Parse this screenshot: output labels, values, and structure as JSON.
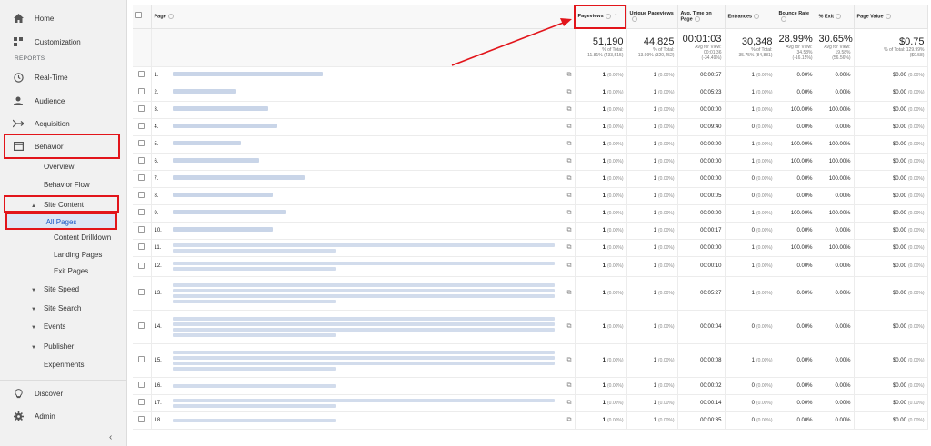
{
  "nav": {
    "home": "Home",
    "customization": "Customization",
    "reports": "REPORTS",
    "realtime": "Real-Time",
    "audience": "Audience",
    "acquisition": "Acquisition",
    "behavior": "Behavior",
    "overview": "Overview",
    "behavior_flow": "Behavior Flow",
    "site_content": "Site Content",
    "all_pages": "All Pages",
    "content_drilldown": "Content Drilldown",
    "landing_pages": "Landing Pages",
    "exit_pages": "Exit Pages",
    "site_speed": "Site Speed",
    "site_search": "Site Search",
    "events": "Events",
    "publisher": "Publisher",
    "experiments": "Experiments",
    "discover": "Discover",
    "admin": "Admin",
    "collapse": "‹"
  },
  "columns": {
    "page": "Page",
    "pageviews": "Pageviews",
    "unique": "Unique Pageviews",
    "avg_time": "Avg. Time on Page",
    "entrances": "Entrances",
    "bounce": "Bounce Rate",
    "exit": "% Exit",
    "value": "Page Value"
  },
  "totals": {
    "pageviews": "51,190",
    "pageviews_sub1": "% of Total:",
    "pageviews_sub2": "11.81% (433,515)",
    "unique": "44,825",
    "unique_sub1": "% of Total:",
    "unique_sub2": "13.99% (320,452)",
    "avg_time": "00:01:03",
    "avg_time_sub1": "Avg for View:",
    "avg_time_sub2": "00:01:36",
    "avg_time_sub3": "(-34.49%)",
    "entrances": "30,348",
    "entrances_sub1": "% of Total:",
    "entrances_sub2": "35.75% (84,881)",
    "bounce": "28.99%",
    "bounce_sub1": "Avg for View:",
    "bounce_sub2": "34.58%",
    "bounce_sub3": "(-16.15%)",
    "exit": "30.65%",
    "exit_sub1": "Avg for View:",
    "exit_sub2": "19.58%",
    "exit_sub3": "(56.56%)",
    "value": "$0.75",
    "value_sub1": "% of Total: 129.99%",
    "value_sub2": "($0.58)"
  },
  "rows": [
    {
      "n": "1.",
      "pv": "1",
      "pvp": "(0.00%)",
      "u": "1",
      "up": "(0.00%)",
      "t": "00:00:57",
      "e": "1",
      "ep": "(0.00%)",
      "b": "0.00%",
      "x": "0.00%",
      "v": "$0.00",
      "vp": "(0.00%)"
    },
    {
      "n": "2.",
      "pv": "1",
      "pvp": "(0.00%)",
      "u": "1",
      "up": "(0.00%)",
      "t": "00:05:23",
      "e": "1",
      "ep": "(0.00%)",
      "b": "0.00%",
      "x": "0.00%",
      "v": "$0.00",
      "vp": "(0.00%)"
    },
    {
      "n": "3.",
      "pv": "1",
      "pvp": "(0.00%)",
      "u": "1",
      "up": "(0.00%)",
      "t": "00:00:00",
      "e": "1",
      "ep": "(0.00%)",
      "b": "100.00%",
      "x": "100.00%",
      "v": "$0.00",
      "vp": "(0.00%)"
    },
    {
      "n": "4.",
      "pv": "1",
      "pvp": "(0.00%)",
      "u": "1",
      "up": "(0.00%)",
      "t": "00:09:40",
      "e": "0",
      "ep": "(0.00%)",
      "b": "0.00%",
      "x": "0.00%",
      "v": "$0.00",
      "vp": "(0.00%)"
    },
    {
      "n": "5.",
      "pv": "1",
      "pvp": "(0.00%)",
      "u": "1",
      "up": "(0.00%)",
      "t": "00:00:00",
      "e": "1",
      "ep": "(0.00%)",
      "b": "100.00%",
      "x": "100.00%",
      "v": "$0.00",
      "vp": "(0.00%)"
    },
    {
      "n": "6.",
      "pv": "1",
      "pvp": "(0.00%)",
      "u": "1",
      "up": "(0.00%)",
      "t": "00:00:00",
      "e": "1",
      "ep": "(0.00%)",
      "b": "100.00%",
      "x": "100.00%",
      "v": "$0.00",
      "vp": "(0.00%)"
    },
    {
      "n": "7.",
      "pv": "1",
      "pvp": "(0.00%)",
      "u": "1",
      "up": "(0.00%)",
      "t": "00:00:00",
      "e": "0",
      "ep": "(0.00%)",
      "b": "0.00%",
      "x": "100.00%",
      "v": "$0.00",
      "vp": "(0.00%)"
    },
    {
      "n": "8.",
      "pv": "1",
      "pvp": "(0.00%)",
      "u": "1",
      "up": "(0.00%)",
      "t": "00:00:05",
      "e": "0",
      "ep": "(0.00%)",
      "b": "0.00%",
      "x": "0.00%",
      "v": "$0.00",
      "vp": "(0.00%)"
    },
    {
      "n": "9.",
      "pv": "1",
      "pvp": "(0.00%)",
      "u": "1",
      "up": "(0.00%)",
      "t": "00:00:00",
      "e": "1",
      "ep": "(0.00%)",
      "b": "100.00%",
      "x": "100.00%",
      "v": "$0.00",
      "vp": "(0.00%)"
    },
    {
      "n": "10.",
      "pv": "1",
      "pvp": "(0.00%)",
      "u": "1",
      "up": "(0.00%)",
      "t": "00:00:17",
      "e": "0",
      "ep": "(0.00%)",
      "b": "0.00%",
      "x": "0.00%",
      "v": "$0.00",
      "vp": "(0.00%)"
    },
    {
      "n": "11.",
      "pv": "1",
      "pvp": "(0.00%)",
      "u": "1",
      "up": "(0.00%)",
      "t": "00:00:00",
      "e": "1",
      "ep": "(0.00%)",
      "b": "100.00%",
      "x": "100.00%",
      "v": "$0.00",
      "vp": "(0.00%)"
    },
    {
      "n": "12.",
      "pv": "1",
      "pvp": "(0.00%)",
      "u": "1",
      "up": "(0.00%)",
      "t": "00:00:10",
      "e": "1",
      "ep": "(0.00%)",
      "b": "0.00%",
      "x": "0.00%",
      "v": "$0.00",
      "vp": "(0.00%)"
    },
    {
      "n": "13.",
      "pv": "1",
      "pvp": "(0.00%)",
      "u": "1",
      "up": "(0.00%)",
      "t": "00:05:27",
      "e": "1",
      "ep": "(0.00%)",
      "b": "0.00%",
      "x": "0.00%",
      "v": "$0.00",
      "vp": "(0.00%)"
    },
    {
      "n": "14.",
      "pv": "1",
      "pvp": "(0.00%)",
      "u": "1",
      "up": "(0.00%)",
      "t": "00:00:04",
      "e": "0",
      "ep": "(0.00%)",
      "b": "0.00%",
      "x": "0.00%",
      "v": "$0.00",
      "vp": "(0.00%)"
    },
    {
      "n": "15.",
      "pv": "1",
      "pvp": "(0.00%)",
      "u": "1",
      "up": "(0.00%)",
      "t": "00:00:08",
      "e": "1",
      "ep": "(0.00%)",
      "b": "0.00%",
      "x": "0.00%",
      "v": "$0.00",
      "vp": "(0.00%)"
    },
    {
      "n": "16.",
      "pv": "1",
      "pvp": "(0.00%)",
      "u": "1",
      "up": "(0.00%)",
      "t": "00:00:02",
      "e": "0",
      "ep": "(0.00%)",
      "b": "0.00%",
      "x": "0.00%",
      "v": "$0.00",
      "vp": "(0.00%)"
    },
    {
      "n": "17.",
      "pv": "1",
      "pvp": "(0.00%)",
      "u": "1",
      "up": "(0.00%)",
      "t": "00:00:14",
      "e": "0",
      "ep": "(0.00%)",
      "b": "0.00%",
      "x": "0.00%",
      "v": "$0.00",
      "vp": "(0.00%)"
    },
    {
      "n": "18.",
      "pv": "1",
      "pvp": "(0.00%)",
      "u": "1",
      "up": "(0.00%)",
      "t": "00:00:35",
      "e": "0",
      "ep": "(0.00%)",
      "b": "0.00%",
      "x": "0.00%",
      "v": "$0.00",
      "vp": "(0.00%)"
    }
  ],
  "colors": {
    "highlight": "#e2151b",
    "active_bg": "#dde6f5",
    "active_text": "#1a56c4"
  }
}
